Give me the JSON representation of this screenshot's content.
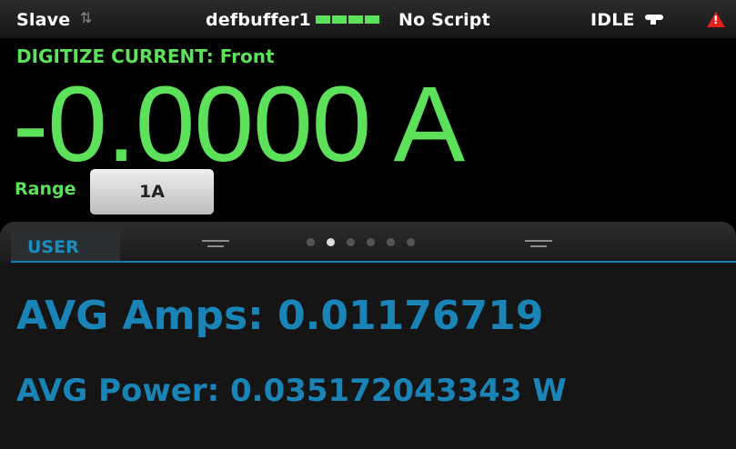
{
  "status_bar": {
    "mode": "Slave",
    "buffer": "defbuffer1",
    "script": "No Script",
    "state": "IDLE"
  },
  "measurement": {
    "function": "DIGITIZE CURRENT: Front",
    "reading": "-0.0000 A"
  },
  "range": {
    "label": "Range",
    "value": "1A"
  },
  "swipe": {
    "tab": "USER",
    "page_count": 6,
    "active_page": 2
  },
  "user_screen": {
    "line1": "AVG Amps: 0.01176719",
    "line2": "AVG Power: 0.035172043343 W"
  },
  "colors": {
    "reading_green": "#5de05a",
    "user_blue": "#1a84b7",
    "warning_red": "#e0201e"
  },
  "icons": [
    "transfer-arrows-icon",
    "buffer-level-icon",
    "trigger-key-icon",
    "warning-icon"
  ]
}
